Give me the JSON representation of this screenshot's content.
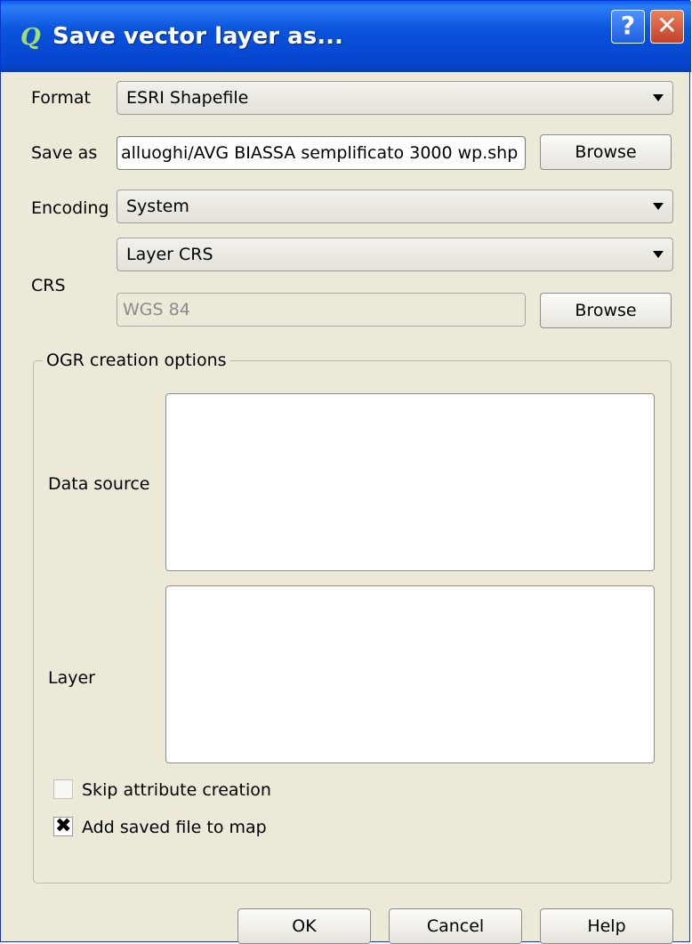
{
  "window": {
    "title": "Save vector layer as...",
    "icon": "qgis-icon",
    "help_label": "?",
    "close_label": "✕"
  },
  "form": {
    "format_label": "Format",
    "format_value": "ESRI Shapefile",
    "saveas_label": "Save as",
    "saveas_value": "alluoghi/AVG BIASSA semplificato 3000 wp.shp",
    "browse_label": "Browse",
    "encoding_label": "Encoding",
    "encoding_value": "System",
    "crs_label": "CRS",
    "crs_mode_value": "Layer CRS",
    "crs_value": "WGS 84",
    "crs_browse_label": "Browse"
  },
  "ogr": {
    "title": "OGR creation options",
    "datasource_label": "Data source",
    "layer_label": "Layer"
  },
  "options": {
    "skip_attr_label": "Skip attribute creation",
    "skip_attr_checked": false,
    "add_map_label": "Add saved file to map",
    "add_map_checked": true,
    "check_mark": "✖"
  },
  "buttons": {
    "ok": "OK",
    "cancel": "Cancel",
    "help": "Help"
  }
}
